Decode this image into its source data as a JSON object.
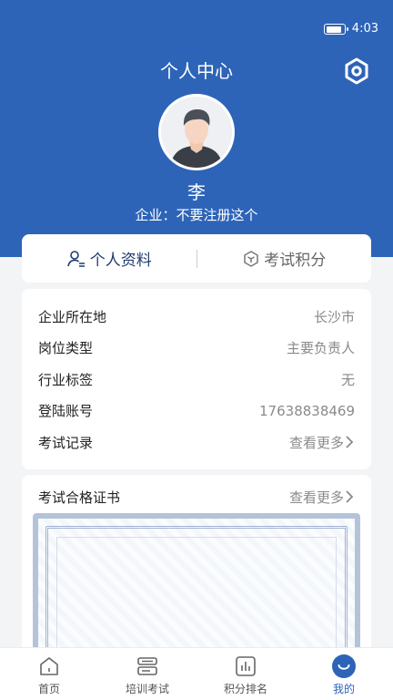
{
  "status_bar": {
    "time": "4:03",
    "battery_level": 0.8
  },
  "header": {
    "title": "个人中心"
  },
  "profile": {
    "name": "李",
    "company_label": "企业：",
    "company_name": "不要注册这个"
  },
  "tabs": [
    {
      "label": "个人资料",
      "icon": "user-icon",
      "active": true
    },
    {
      "label": "考试积分",
      "icon": "hexagon-icon",
      "active": false
    }
  ],
  "info": {
    "rows": [
      {
        "label": "企业所在地",
        "value": "长沙市"
      },
      {
        "label": "岗位类型",
        "value": "主要负责人"
      },
      {
        "label": "行业标签",
        "value": "无"
      },
      {
        "label": "登陆账号",
        "value": "17638838469"
      },
      {
        "label": "考试记录",
        "value": "查看更多"
      }
    ]
  },
  "certificate": {
    "title": "考试合格证书",
    "more": "查看更多"
  },
  "bottom_nav": [
    {
      "label": "首页",
      "icon": "home-icon"
    },
    {
      "label": "培训考试",
      "icon": "book-icon"
    },
    {
      "label": "积分排名",
      "icon": "chart-icon"
    },
    {
      "label": "我的",
      "icon": "profile-icon",
      "active": true
    }
  ],
  "colors": {
    "primary": "#2d64b8",
    "tab_active": "#1f3b6e"
  }
}
